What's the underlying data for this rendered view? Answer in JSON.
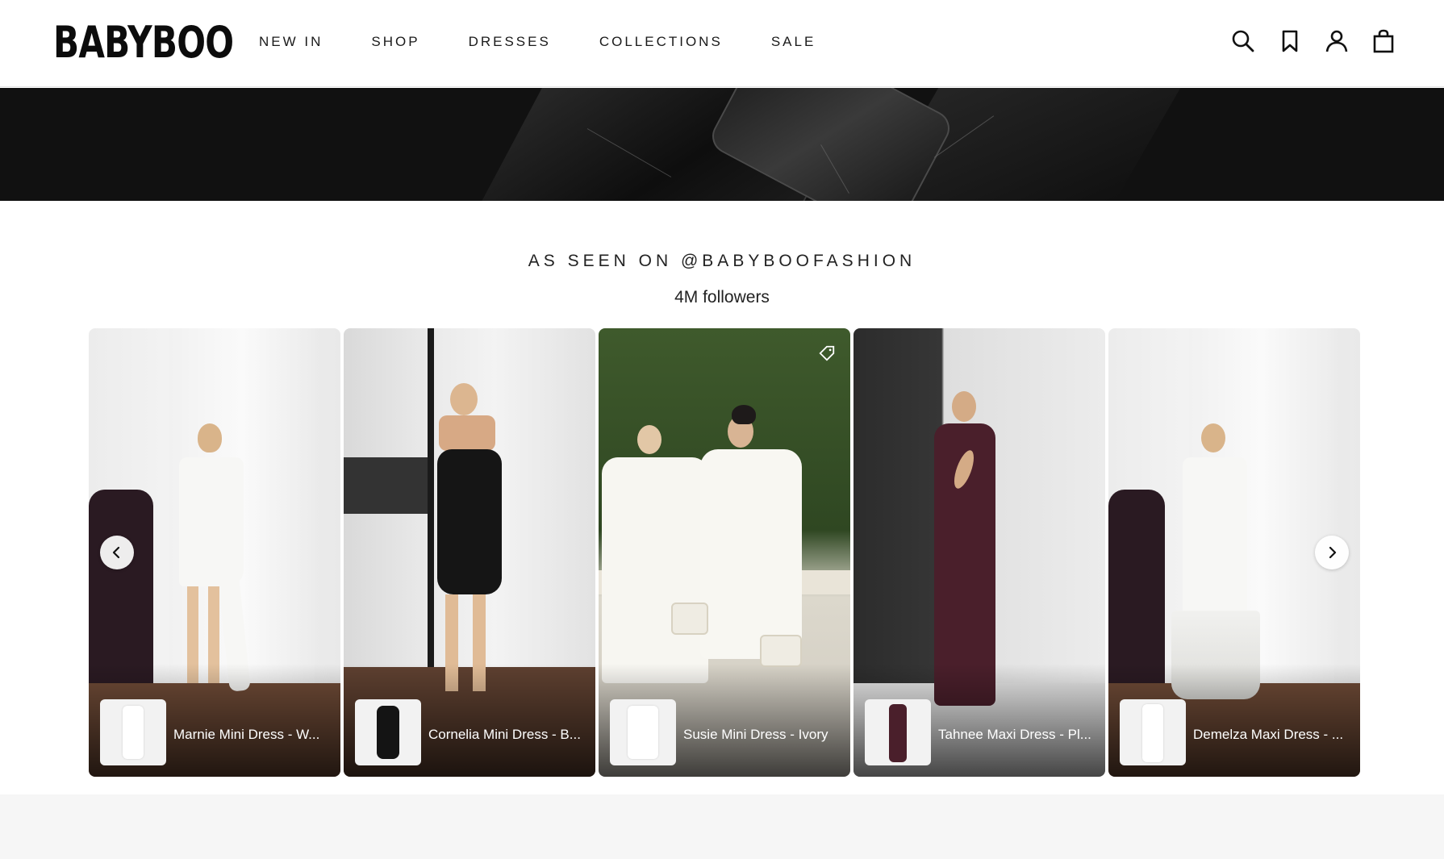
{
  "header": {
    "logo": "BABYBOO",
    "nav": [
      "NEW IN",
      "SHOP",
      "DRESSES",
      "COLLECTIONS",
      "SALE"
    ],
    "icons": [
      "search-icon",
      "bookmark-icon",
      "account-icon",
      "bag-icon"
    ]
  },
  "section": {
    "title": "AS SEEN ON @BABYBOOFASHION",
    "followers": "4M followers"
  },
  "cards": [
    {
      "label": "Marnie Mini Dress - W...",
      "dress_color": "#f4f4f2"
    },
    {
      "label": "Cornelia Mini Dress - B...",
      "dress_color": "#161616"
    },
    {
      "label": "Susie Mini Dress - Ivory",
      "dress_color": "#f6f4ee"
    },
    {
      "label": "Tahnee Maxi Dress - Pl...",
      "dress_color": "#4a1f2b"
    },
    {
      "label": "Demelza Maxi Dress - ...",
      "dress_color": "#f1f1ef"
    }
  ],
  "colors": {
    "accent": "#111111",
    "background": "#ffffff"
  }
}
